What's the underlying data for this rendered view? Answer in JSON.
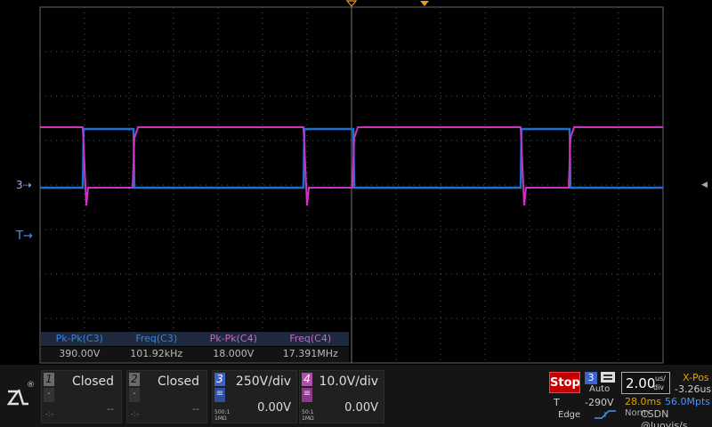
{
  "colors": {
    "ch3": "#1f6fd0",
    "ch4": "#cc33c0",
    "trigger": "#e89a1a",
    "stop": "#c40000",
    "grid": "#555555"
  },
  "waveform": {
    "ch3_high_level": 145,
    "ch3_low_level": 211,
    "ch4_high_level": 143,
    "ch4_low_level": 211,
    "edges": [
      93,
      151,
      341,
      398,
      585,
      641
    ]
  },
  "markers": {
    "c34": "3",
    "trigger": "T"
  },
  "measurements": [
    {
      "label": "Pk-Pk(C3)",
      "value": "390.00V"
    },
    {
      "label": "Freq(C3)",
      "value": "101.92kHz"
    },
    {
      "label": "Pk-Pk(C4)",
      "value": "18.000V"
    },
    {
      "label": "Freq(C4)",
      "value": "17.391MHz"
    }
  ],
  "channels": {
    "ch1": {
      "num": "1",
      "state": "Closed",
      "offset": "--",
      "sub": "-"
    },
    "ch2": {
      "num": "2",
      "state": "Closed",
      "offset": "--",
      "sub": "-"
    },
    "ch3": {
      "num": "3",
      "scale": "250V/div",
      "offset": "0.00V",
      "probe": "500:1",
      "impedance": "1MΩ"
    },
    "ch4": {
      "num": "4",
      "scale": "10.0V/div",
      "offset": "0.00V",
      "probe": "50:1",
      "impedance": "1MΩ"
    }
  },
  "dotted": "-:-",
  "logo_reg": "®",
  "acquisition": {
    "run_state": "Stop"
  },
  "trigger": {
    "source": "3",
    "mode": "Auto",
    "letter": "T",
    "level": "-290V",
    "type": "Edge"
  },
  "timebase": {
    "value": "2.00",
    "unit_top": "us/",
    "unit_bottom": "div"
  },
  "xpos": {
    "label": "X-Pos",
    "value": "-3.26us"
  },
  "acq_info": {
    "time": "28.0ms",
    "rate": "56.0Mpts",
    "mode": "Norm"
  },
  "watermark": "CSDN @luoyis/s"
}
